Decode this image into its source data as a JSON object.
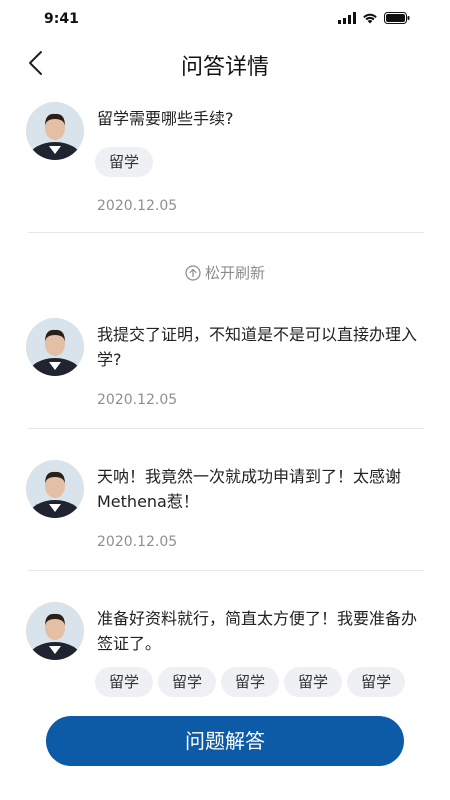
{
  "status_bar": {
    "time": "9:41"
  },
  "nav": {
    "title": "问答详情"
  },
  "refresh_label": "松开刷新",
  "posts": [
    {
      "question": "留学需要哪些手续?",
      "tags": [
        "留学"
      ],
      "date": "2020.12.05"
    },
    {
      "question": "我提交了证明，不知道是不是可以直接办理入学?",
      "tags": [],
      "date": "2020.12.05"
    },
    {
      "question": "天呐！我竟然一次就成功申请到了！太感谢Methena惹！",
      "tags": [],
      "date": "2020.12.05"
    },
    {
      "question": "准备好资料就行，简直太方便了！我要准备办签证了。",
      "tags": [
        "留学",
        "留学",
        "留学",
        "留学",
        "留学"
      ],
      "date": ""
    }
  ],
  "answer_button": {
    "label": "问题解答"
  }
}
